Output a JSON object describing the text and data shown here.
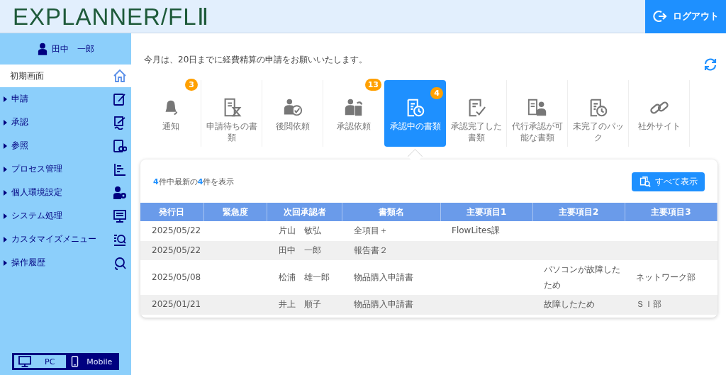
{
  "header": {
    "logo": "EXPLANNER/FLⅡ",
    "logout": "ログアウト"
  },
  "sidebar": {
    "user": "田中　一郎",
    "home": "初期画面",
    "items": [
      {
        "label": "申請",
        "expanded": false
      },
      {
        "label": "承認",
        "expanded": false
      },
      {
        "label": "参照",
        "expanded": false
      },
      {
        "label": "プロセス管理",
        "expanded": false
      },
      {
        "label": "個人環境設定",
        "expanded": false
      },
      {
        "label": "システム処理",
        "expanded": false
      },
      {
        "label": "カスタマイズメニュー",
        "expanded": false
      },
      {
        "label": "操作履歴",
        "expanded": false
      }
    ],
    "view_toggle": [
      {
        "label": "PC",
        "selected": true
      },
      {
        "label": "Mobile",
        "selected": false
      }
    ]
  },
  "notice": "今月は、20日までに経費精算の申請をお願いいたします。",
  "tiles": [
    {
      "label": "通知",
      "badge": "3",
      "selected": false
    },
    {
      "label": "申請待ちの書類",
      "selected": false
    },
    {
      "label": "後閲依頼",
      "selected": false
    },
    {
      "label": "承認依頼",
      "badge": "13",
      "selected": false
    },
    {
      "label": "承認中の書類",
      "badge": "4",
      "selected": true
    },
    {
      "label": "承認完了した書類",
      "selected": false
    },
    {
      "label": "代行承認が可能な書類",
      "selected": false
    },
    {
      "label": "未完了のパック",
      "selected": false
    },
    {
      "label": "社外サイト",
      "selected": false
    }
  ],
  "panel": {
    "summary": "**4**件中最新の**4**件を表示",
    "show_all": "すべて表示",
    "table": {
      "columns": [
        "発行日",
        "緊急度",
        "次回承認者",
        "書類名",
        "主要項目1",
        "主要項目2",
        "主要項目3"
      ],
      "rows": [
        [
          "2025/05/22",
          "",
          "片山　敏弘",
          "全項目＋",
          "FlowLites課",
          "",
          ""
        ],
        [
          "2025/05/22",
          "",
          "田中　一郎",
          "報告書２",
          "",
          "",
          ""
        ],
        [
          "2025/05/08",
          "",
          "松浦　雄一郎",
          "物品購入申請書",
          "",
          "パソコンが故障したため",
          "ネットワーク部"
        ],
        [
          "2025/01/21",
          "",
          "井上　順子",
          "物品購入申請書",
          "",
          "故障したため",
          "ＳＩ部"
        ]
      ]
    }
  }
}
